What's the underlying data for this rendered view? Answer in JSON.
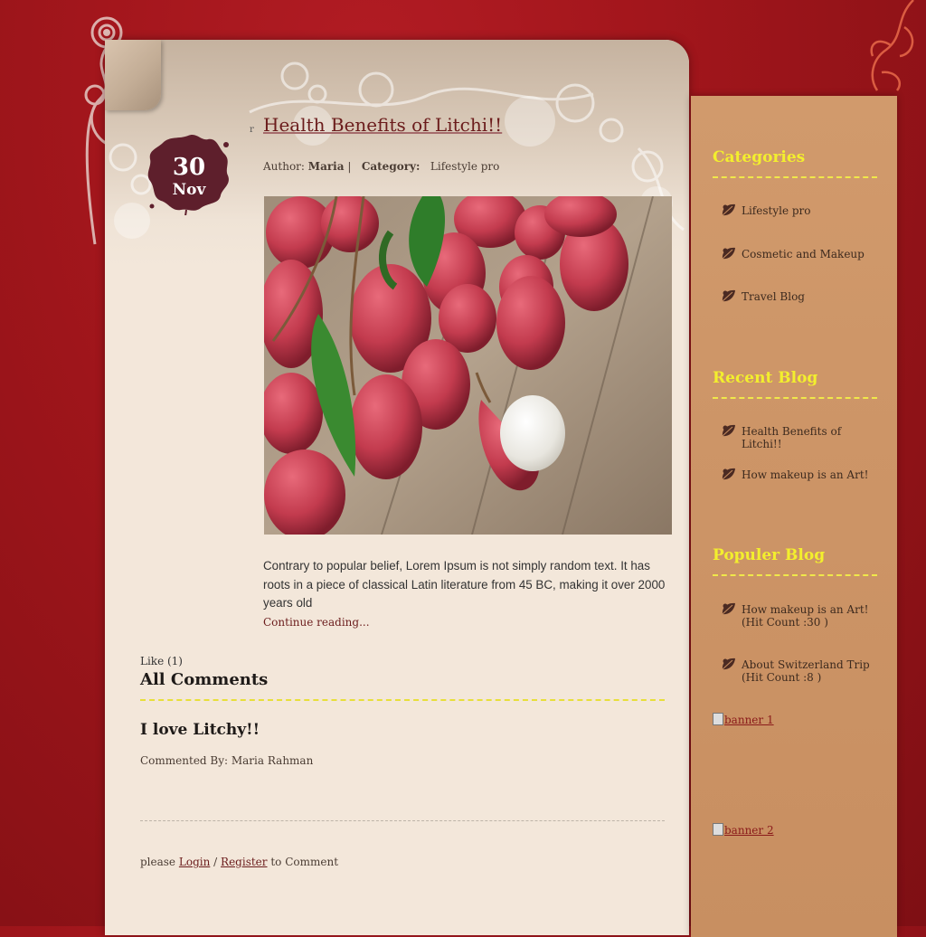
{
  "post": {
    "title": "Health Benefits of Litchi!!",
    "title_marker": "r",
    "date_day": "30",
    "date_month": "Nov",
    "author_label": "Author:",
    "author": "Maria",
    "category_label": "Category:",
    "category": "Lifestyle pro",
    "excerpt": "Contrary to popular belief, Lorem Ipsum is not simply random text. It has roots in a piece of classical Latin literature from 45 BC, making it over 2000 years old",
    "continue": "Continue reading...",
    "like": "Like (1)"
  },
  "comments": {
    "heading": "All Comments",
    "items": [
      {
        "text": "I love Litchy!!",
        "author": "Commented By: Maria Rahman"
      }
    ],
    "login_prefix": "please",
    "login": "Login",
    "separator": "/",
    "register": "Register",
    "login_suffix": "to Comment"
  },
  "sidebar": {
    "categories": {
      "heading": "Categories",
      "items": [
        "Lifestyle pro",
        "Cosmetic and Makeup",
        "Travel Blog"
      ]
    },
    "recent": {
      "heading": "Recent Blog",
      "items": [
        "Health Benefits of Litchi!!",
        "How makeup is an Art!"
      ]
    },
    "popular": {
      "heading": "Populer Blog",
      "items": [
        "How makeup is an Art! (Hit Count :30 )",
        "About Switzerland Trip (Hit Count :8 )"
      ]
    },
    "banners": [
      "banner 1",
      "banner 2"
    ]
  },
  "colors": {
    "background": "#a3161c",
    "card": "#f3e7da",
    "sidebar": "#cd9567",
    "heading_yellow": "#f3ef2d",
    "link": "#6b1c1c"
  }
}
